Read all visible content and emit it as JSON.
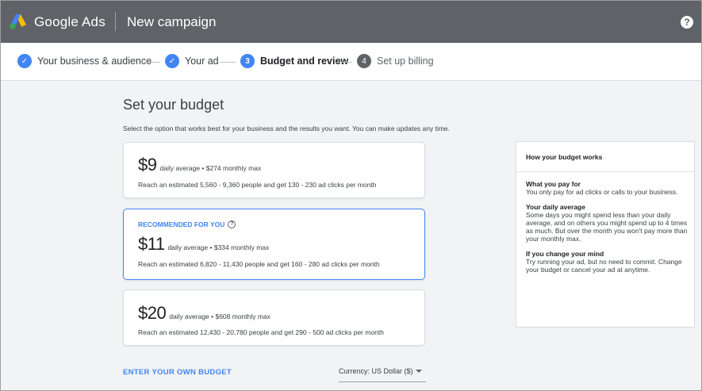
{
  "header": {
    "brand": "Google Ads",
    "title": "New campaign",
    "help_icon": "help-icon"
  },
  "steps": [
    {
      "label": "Your business & audience",
      "state": "done",
      "marker": "✓"
    },
    {
      "label": "Your ad",
      "state": "done",
      "marker": "✓"
    },
    {
      "label": "Budget and review",
      "state": "active",
      "marker": "3"
    },
    {
      "label": "Set up billing",
      "state": "todo",
      "marker": "4"
    }
  ],
  "main": {
    "title": "Set your budget",
    "description": "Select the option that works best for your business and the results you want. You can make updates any time.",
    "options": [
      {
        "amount": "$9",
        "detail": "daily average • $274 monthly max",
        "reach": "Reach an estimated 5,560 - 9,360 people and get 130 - 230 ad clicks per month",
        "recommended": false
      },
      {
        "amount": "$11",
        "detail": "daily average • $334 monthly max",
        "reach": "Reach an estimated 6,820 - 11,430 people and get 160 - 280 ad clicks per month",
        "recommended": true,
        "recommended_label": "RECOMMENDED FOR YOU"
      },
      {
        "amount": "$20",
        "detail": "daily average • $608 monthly max",
        "reach": "Reach an estimated 12,430 - 20,780 people and get 290 - 500 ad clicks per month",
        "recommended": false
      }
    ],
    "own_budget_link": "ENTER YOUR OWN BUDGET",
    "currency": "Currency: US Dollar ($)"
  },
  "info_panel": {
    "title": "How your budget works",
    "sections": [
      {
        "heading": "What you pay for",
        "text": "You only pay for ad clicks or calls to your business."
      },
      {
        "heading": "Your daily average",
        "text": "Some days you might spend less than your daily average, and on others you might spend up to 4 times as much. But over the month you won't pay more than your monthly max."
      },
      {
        "heading": "If you change your mind",
        "text": "Try running your ad, but no need to commit. Change your budget or cancel your ad at anytime."
      }
    ]
  },
  "colors": {
    "header_bg": "#5f6368",
    "accent": "#4285f4",
    "page_bg": "#f1f3f4"
  }
}
